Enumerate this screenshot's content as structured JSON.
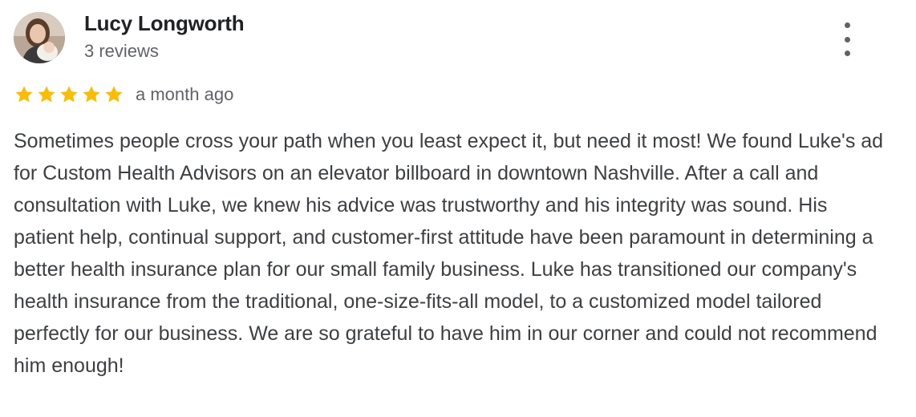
{
  "review": {
    "author": {
      "name": "Lucy Longworth",
      "reviews_count_text": "3 reviews",
      "avatar_icon": "profile-photo"
    },
    "menu_icon": "more-vertical-icon",
    "rating": {
      "stars": 5,
      "max_stars": 5,
      "star_color": "#FBBC04"
    },
    "date": "a month ago",
    "text": "Sometimes people cross your path when you least expect it, but need it most! We found Luke's ad for Custom Health Advisors on an elevator billboard in downtown Nashville. After a call and consultation with Luke, we knew his advice was trustworthy and his integrity was sound. His patient help, continual support, and customer-first attitude have been paramount in determining a better health insurance plan for our small family business. Luke has transitioned our company's health insurance from the traditional, one-size-fits-all model, to a customized model tailored perfectly for our business. We are so grateful to have him in our corner and could not recommend him enough!"
  },
  "colors": {
    "name_text": "#202124",
    "secondary_text": "#5f6368",
    "body_text": "#3c4043",
    "star": "#FBBC04"
  }
}
